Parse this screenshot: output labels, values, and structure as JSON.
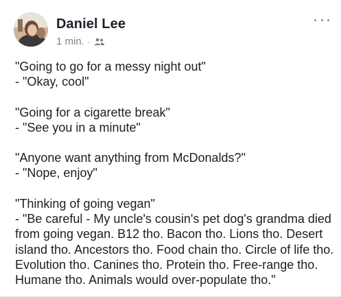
{
  "post": {
    "author": "Daniel Lee",
    "time": "1 min.",
    "separator": "·",
    "audience_icon": "friends-icon",
    "more_icon": "more-options-icon",
    "blocks": [
      {
        "lines": [
          "\"Going to go for a messy night out\"",
          "- \"Okay, cool\""
        ]
      },
      {
        "lines": [
          "\"Going for a cigarette break\"",
          "- \"See you in a minute\""
        ]
      },
      {
        "lines": [
          "\"Anyone want anything from McDonalds?\"",
          "- \"Nope, enjoy\""
        ]
      },
      {
        "lines": [
          "\"Thinking of going vegan\"",
          "- \"Be careful - My uncle's cousin's pet dog's grandma died",
          "from going vegan. B12 tho. Bacon tho. Lions tho. Desert",
          "island tho. Ancestors tho. Food chain tho. Circle of life tho.",
          "Evolution tho. Canines tho. Protein tho. Free-range tho.",
          "Humane tho. Animals would over-populate tho.\""
        ]
      }
    ]
  }
}
